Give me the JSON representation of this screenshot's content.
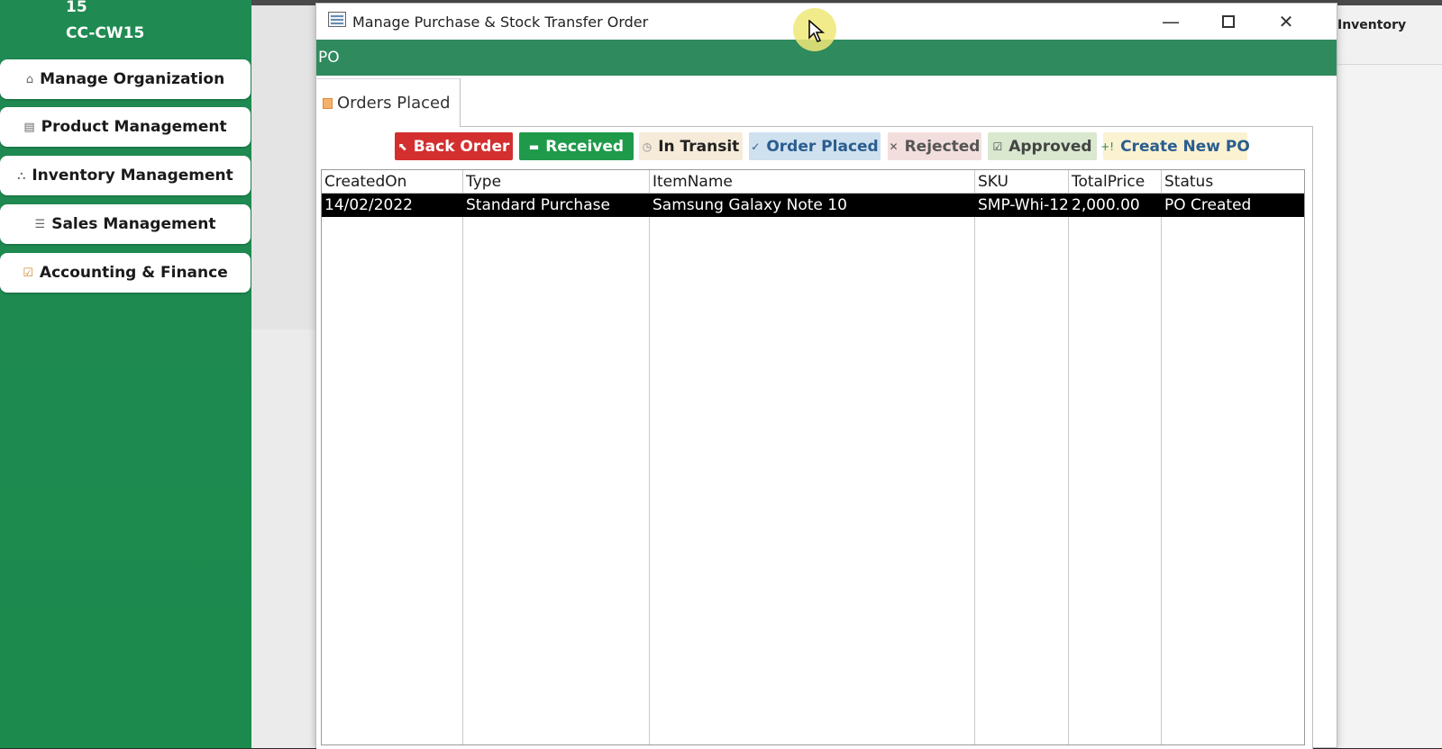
{
  "sidebar": {
    "code_top": "15",
    "code_bottom": "CC-CW15",
    "items": [
      {
        "label": "Manage Organization",
        "icon": "home-icon"
      },
      {
        "label": "Product Management",
        "icon": "list-icon"
      },
      {
        "label": "Inventory Management",
        "icon": "boxes-icon"
      },
      {
        "label": "Sales Management",
        "icon": "document-icon"
      },
      {
        "label": "Accounting & Finance",
        "icon": "clipboard-icon"
      }
    ]
  },
  "background": {
    "right_label": "Inventory"
  },
  "dialog": {
    "title": "Manage Purchase & Stock Transfer Order",
    "section": "PO",
    "tab_label": "Orders Placed",
    "toolbar": {
      "back_order": "Back Order",
      "received": "Received",
      "in_transit": "In Transit",
      "order_placed": "Order Placed",
      "rejected": "Rejected",
      "approved": "Approved",
      "create_new_po": "Create New PO"
    },
    "grid": {
      "columns": [
        "CreatedOn",
        "Type",
        "ItemName",
        "SKU",
        "TotalPrice",
        "Status"
      ],
      "rows": [
        [
          "14/02/2022",
          "Standard Purchase",
          "Samsung Galaxy Note 10",
          "SMP-Whi-12",
          "2,000.00",
          "PO Created"
        ]
      ]
    }
  },
  "colors": {
    "sidebar_green": "#1f8a52",
    "po_bar_green": "#2f8a5e",
    "back_order_red": "#d32f2f",
    "received_green": "#1f9a4a",
    "in_transit_bg": "#f6ead8",
    "order_placed_bg": "#cfe0ef",
    "rejected_bg": "#f3dede",
    "approved_bg": "#d9e8cf",
    "create_new_bg": "#fbf2d2",
    "selected_row": "#000000"
  }
}
